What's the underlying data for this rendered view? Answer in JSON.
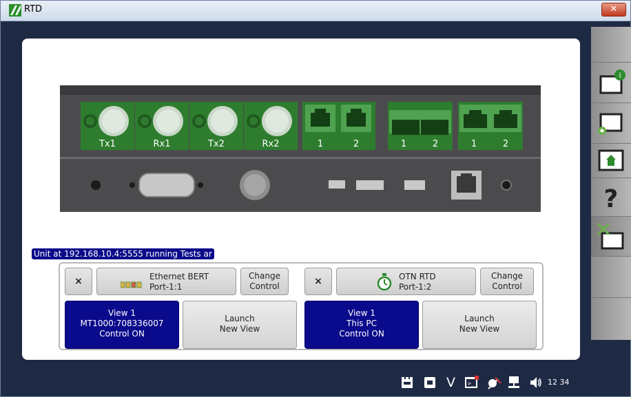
{
  "window": {
    "title": "RTD",
    "close_label": "✕"
  },
  "device": {
    "bnc_labels": [
      "Tx1",
      "Rx1",
      "Tx2",
      "Rx2"
    ],
    "sfp_labels": [
      "1",
      "2"
    ],
    "dual_labels": [
      "1",
      "2"
    ],
    "rj_labels": [
      "1",
      "2"
    ]
  },
  "status_text": "Unit at 192.168.10.4:5555 running Tests ar",
  "tests": [
    {
      "close_label": "×",
      "name": "Ethernet BERT",
      "port": "Port-1:1",
      "change_lines": [
        "Change",
        "Control"
      ],
      "view_lines": [
        "View 1",
        "MT1000:708336007",
        "Control ON"
      ],
      "launch_lines": [
        "Launch",
        "New View"
      ]
    },
    {
      "close_label": "×",
      "name": "OTN RTD",
      "port": "Port-1:2",
      "change_lines": [
        "Change",
        "Control"
      ],
      "view_lines": [
        "View 1",
        "This PC",
        "Control ON"
      ],
      "launch_lines": [
        "Launch",
        "New View"
      ]
    }
  ],
  "sidebar": [
    "info-folder-icon",
    "settings-folder-icon",
    "home-folder-icon",
    "help-icon",
    "tools-folder-icon"
  ],
  "taskbar": {
    "v_label": "V",
    "clock": "12 34"
  },
  "colors": {
    "accent": "#0a0a8c",
    "port_green": "#2e7d2e",
    "background": "#1e2944"
  }
}
